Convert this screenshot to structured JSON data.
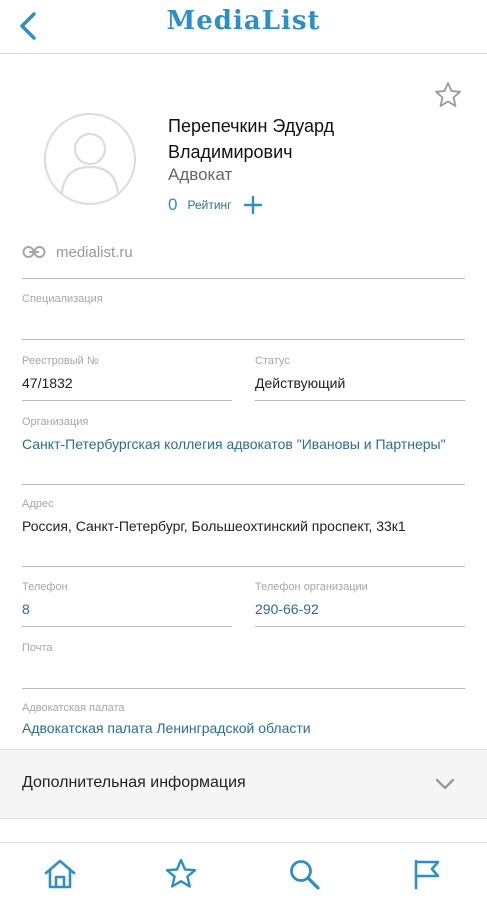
{
  "header": {
    "title": "MediaList"
  },
  "profile": {
    "name": "Перепечкин Эдуард Владимирович",
    "position": "Адвокат",
    "rating_value": "0",
    "rating_label": "Рейтинг",
    "website": "medialist.ru"
  },
  "fields": {
    "specialization": {
      "label": "Специализация",
      "value": ""
    },
    "registry": {
      "label": "Реестровый №",
      "value": "47/1832"
    },
    "status": {
      "label": "Статус",
      "value": "Действующий"
    },
    "organization": {
      "label": "Организация",
      "value": "Санкт-Петербургская коллегия адвокатов \"Ивановы и Партнеры\""
    },
    "address": {
      "label": "Адрес",
      "value": "Россия, Санкт-Петербург, Большеохтинский проспект, 33к1"
    },
    "phone": {
      "label": "Телефон",
      "value": "8"
    },
    "org_phone": {
      "label": "Телефон организации",
      "value": "290-66-92"
    },
    "email": {
      "label": "Почта",
      "value": ""
    },
    "chamber": {
      "label": "Адвокатская палата",
      "value": "Адвокатская палата Ленинградской области"
    }
  },
  "extra": {
    "title": "Дополнительная информация"
  },
  "icons": {
    "back": "chevron-left-icon",
    "favorite": "star-outline-icon",
    "avatar": "user-placeholder-icon",
    "rating_add": "plus-icon",
    "website": "link-icon",
    "expand": "chevron-down-icon",
    "nav": [
      "home-icon",
      "star-icon",
      "search-icon",
      "flag-icon"
    ]
  },
  "colors": {
    "accent": "#2e8fc4",
    "link_text": "#2b6f8d",
    "label_gray": "#a7a7a7"
  }
}
